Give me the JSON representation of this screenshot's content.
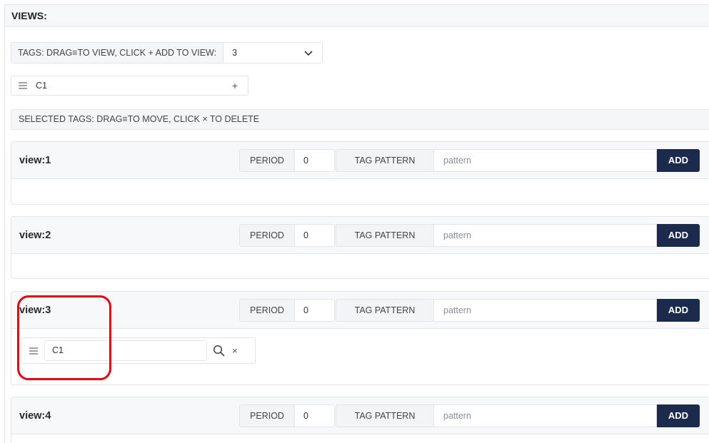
{
  "views_header": "VIEWS:",
  "tags_bar": {
    "label": "TAGS: DRAG≡TO VIEW, CLICK + ADD TO VIEW:",
    "selected_value": "3"
  },
  "tag_chip": {
    "label": "C1",
    "add_symbol": "+"
  },
  "selected_tags_label": "SELECTED TAGS: DRAG≡TO MOVE, CLICK × TO DELETE",
  "view_controls": {
    "period_label": "PERIOD",
    "tag_pattern_label": "TAG PATTERN",
    "add_label": "ADD"
  },
  "views": [
    {
      "title": "view:1",
      "period": "0",
      "pattern_placeholder": "pattern"
    },
    {
      "title": "view:2",
      "period": "0",
      "pattern_placeholder": "pattern"
    },
    {
      "title": "view:3",
      "period": "0",
      "pattern_placeholder": "pattern",
      "tag": "C1",
      "tag_close": "×"
    },
    {
      "title": "view:4",
      "period": "0",
      "pattern_placeholder": "pattern"
    }
  ],
  "colors": {
    "add_button": "#1c2b4d",
    "highlight": "#e3000f"
  },
  "icons": {
    "drag": "drag-handle-icon",
    "chevron": "chevron-down-icon",
    "search": "search-icon",
    "close": "close-icon"
  }
}
